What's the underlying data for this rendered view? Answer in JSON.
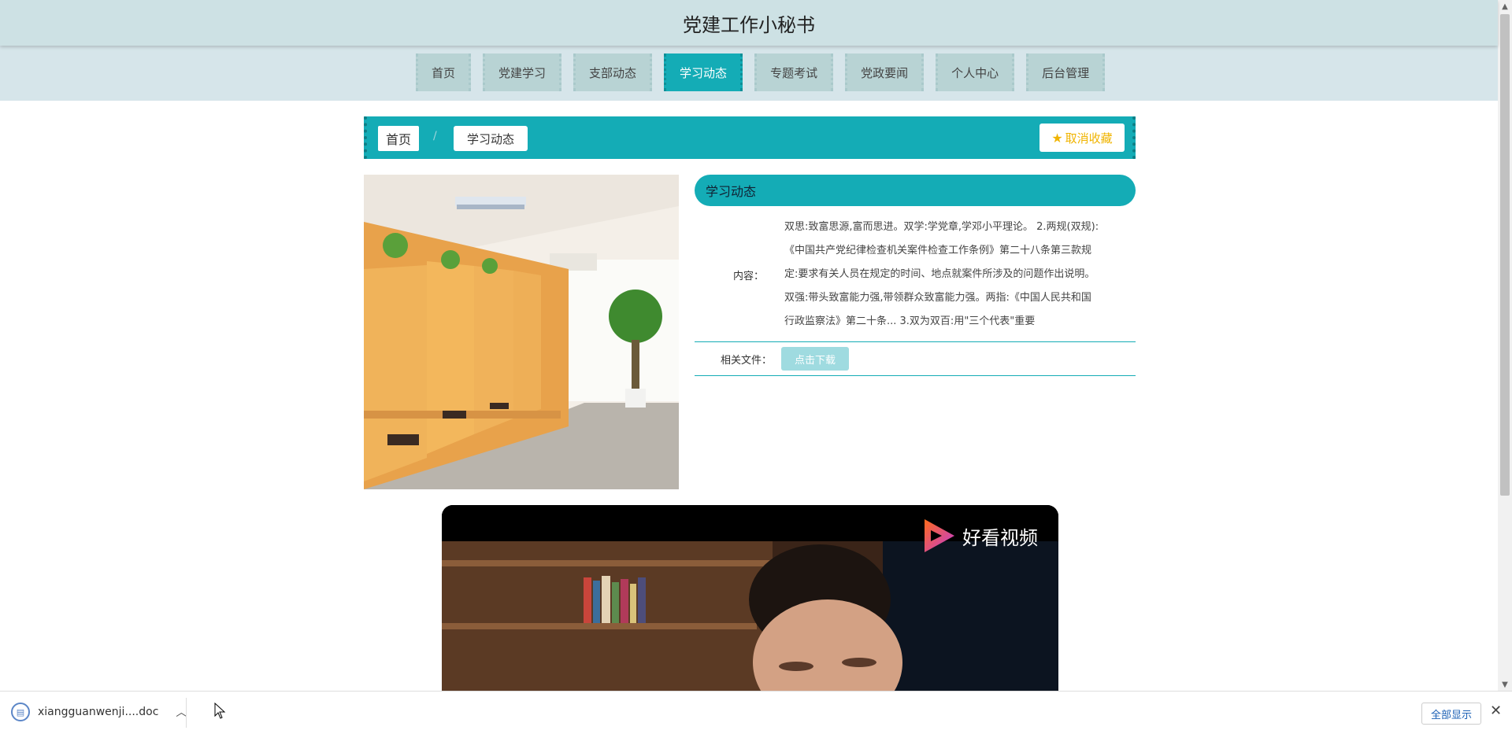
{
  "header": {
    "title": "党建工作小秘书"
  },
  "nav": {
    "items": [
      "首页",
      "党建学习",
      "支部动态",
      "学习动态",
      "专题考试",
      "党政要闻",
      "个人中心",
      "后台管理"
    ],
    "active_index": 3
  },
  "breadcrumb": {
    "home": "首页",
    "separator": "/",
    "current": "学习动态"
  },
  "favorite": {
    "label": "取消收藏",
    "icon": "star-icon"
  },
  "detail": {
    "section_title": "学习动态",
    "content_label": "内容：",
    "content_text": "双思:致富思源,富而思进。双学:学党章,学邓小平理论。 2.两规(双规):《中国共产党纪律检查机关案件检查工作条例》第二十八条第三款规定:要求有关人员在规定的时间、地点就案件所涉及的问题作出说明。双强:带头致富能力强,带领群众致富能力强。两指:《中国人民共和国行政监察法》第二十条... 3.双为双百:用\"三个代表\"重要",
    "file_label": "相关文件：",
    "download_label": "点击下载"
  },
  "video": {
    "logo_text": "好看视频"
  },
  "download_bar": {
    "file_name": "xiangguanwenji....doc",
    "show_all": "全部显示"
  },
  "colors": {
    "accent": "#14acb6",
    "header_bg": "#cde1e4",
    "nav_bg": "#d6e5ea",
    "favorite": "#f0b400"
  }
}
